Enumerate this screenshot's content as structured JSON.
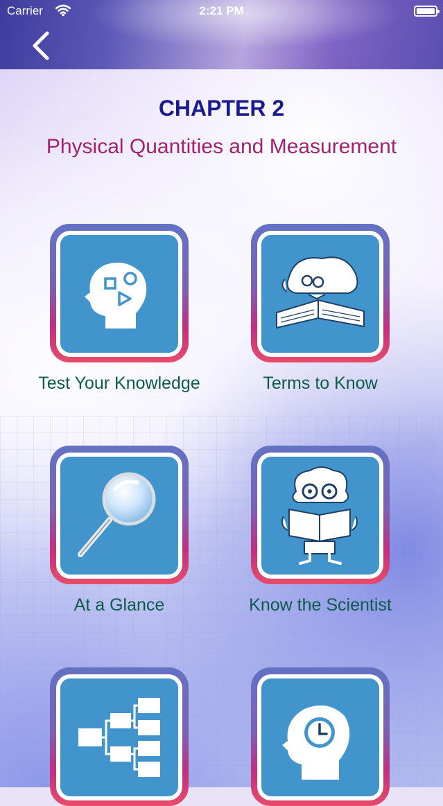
{
  "status_bar": {
    "carrier": "Carrier",
    "time": "2:21 PM"
  },
  "nav": {
    "back_icon": "chevron-left-icon"
  },
  "header": {
    "chapter": "CHAPTER 2",
    "title": "Physical Quantities and Measurement"
  },
  "tiles": [
    {
      "label": "Test Your Knowledge",
      "icon": "head-shapes-icon"
    },
    {
      "label": "Terms to Know",
      "icon": "reading-book-icon"
    },
    {
      "label": "At a Glance",
      "icon": "magnifier-icon"
    },
    {
      "label": "Know the Scientist",
      "icon": "scientist-icon"
    },
    {
      "label": "",
      "icon": "flowchart-icon"
    },
    {
      "label": "",
      "icon": "head-clock-icon"
    }
  ],
  "colors": {
    "chapter": "#1a1a8f",
    "title": "#a1226f",
    "tile_label": "#0c5c4c",
    "tile_blue": "#4195cc"
  }
}
